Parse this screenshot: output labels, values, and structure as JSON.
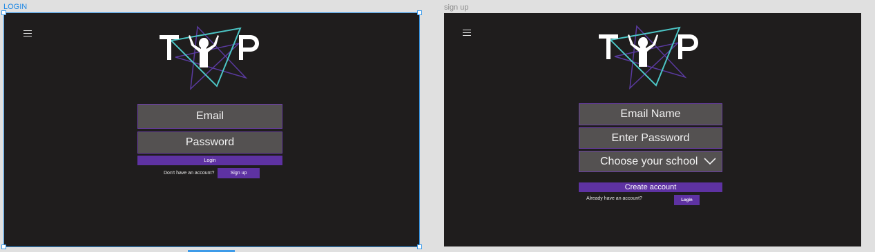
{
  "frames": {
    "login": {
      "label": "LOGIN",
      "email_label": "Email",
      "password_label": "Password",
      "login_button": "Login",
      "no_account_text": "Don't have an account?",
      "signup_button": "Sign up"
    },
    "signup": {
      "label": "sign up",
      "email_label": "Email Name",
      "password_label": "Enter Password",
      "school_select": "Choose your school",
      "create_button": "Create account",
      "have_account_text": "Already have an account?",
      "login_button": "Login"
    }
  },
  "logo": {
    "text_left": "T",
    "text_right": "P"
  },
  "colors": {
    "canvas": "#e0e0e0",
    "frame_bg": "#1f1d1d",
    "field_bg": "#545151",
    "accent_purple": "#5e32a2",
    "logo_teal": "#4cc6c6",
    "logo_purple": "#5a3aa0",
    "selection_blue": "#3d9be9"
  },
  "icons": [
    "menu-icon",
    "chevron-down-icon",
    "logo-icon"
  ]
}
